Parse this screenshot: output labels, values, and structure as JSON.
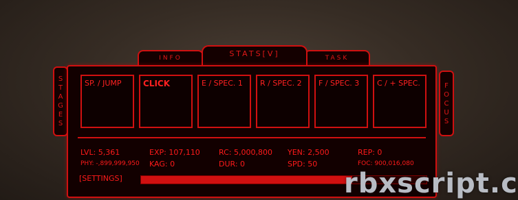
{
  "tabs": {
    "info": "INFO",
    "stats": "STATS[V]",
    "task": "TASK"
  },
  "side_left": [
    "S",
    "T",
    "A",
    "G",
    "E",
    "S"
  ],
  "side_right": [
    "F",
    "O",
    "C",
    "U",
    "S"
  ],
  "slots": [
    "SP. / JUMP",
    "CLICK",
    "E / SPEC. 1",
    "R / SPEC. 2",
    "F / SPEC. 3",
    "C / + SPEC."
  ],
  "stats": {
    "lvl": "LVL: 5,361",
    "exp": "EXP: 107,110",
    "rc": "RC: 5,000,800",
    "yen": "YEN: 2,500",
    "rep": "REP: 0",
    "phy": "PHY: -,899,999,950",
    "kag": "KAG: 0",
    "dur": "DUR: 0",
    "spd": "SPD: 50",
    "foc": "FOC: 900,016,080"
  },
  "settings_label": "[SETTINGS]",
  "progress_fraction": 0.74,
  "watermark": "rbxscript.c",
  "colors": {
    "accent": "#d01010",
    "text": "#ff1a1a",
    "panel_bg": "#120000"
  }
}
